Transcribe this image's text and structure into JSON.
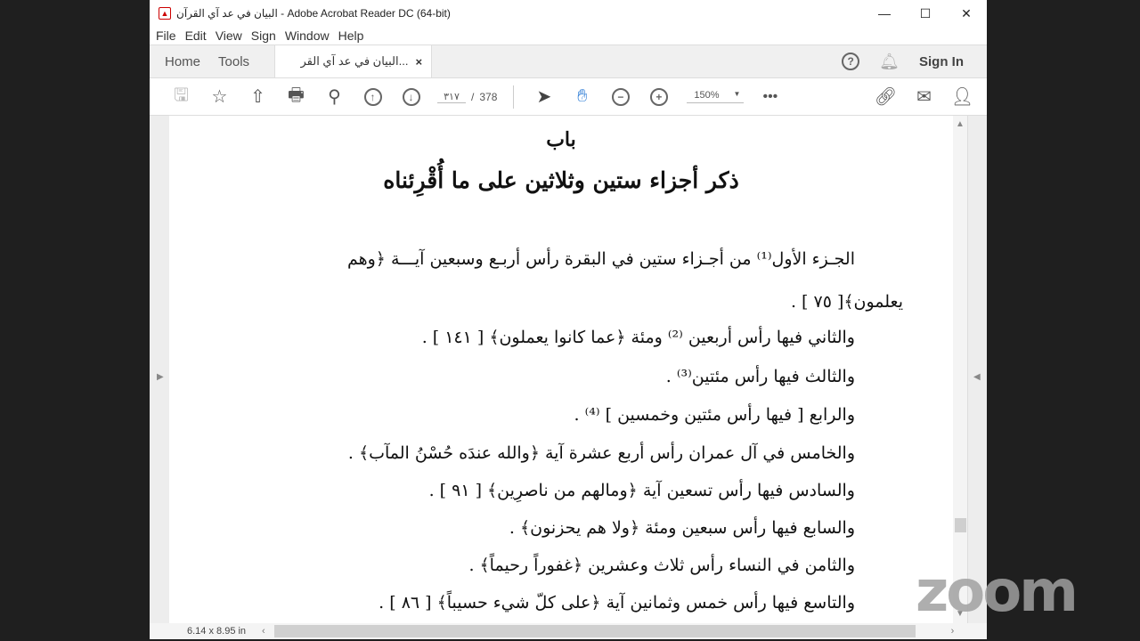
{
  "window": {
    "title": "البيان في عد آي القرآن - Adobe Acrobat Reader DC (64-bit)",
    "minimize": "—",
    "maximize": "☐",
    "close": "✕"
  },
  "menu": [
    "File",
    "Edit",
    "View",
    "Sign",
    "Window",
    "Help"
  ],
  "tabs": {
    "home": "Home",
    "tools": "Tools",
    "document": "البيان في عد آي القر...",
    "close": "×",
    "sign_in": "Sign In"
  },
  "toolbar": {
    "current_page": "٣١٧",
    "page_separator": "/",
    "total_pages": "378",
    "zoom": "150%"
  },
  "statusbar": {
    "page_size": "6.14 x 8.95 in"
  },
  "document": {
    "heading": "باب",
    "subheading": "ذكر أجزاء ستين وثلاثين على ما أُقْرِئناه",
    "lines": [
      "الجـزء الأول⁽¹⁾ من أجـزاء ستين في البقرة رأس أربـع وسبعين آيـــة ﴿وهم",
      "يعلمون﴾[ ٧٥ ] .",
      "والثاني فيها رأس أربعين ⁽²⁾ ومئة ﴿عما كانوا يعملون﴾ [ ١٤١ ] .",
      "والثالث فيها رأس مئتين⁽³⁾ .",
      "والرابع [ فيها رأس مئتين وخمسين ] ⁽⁴⁾ .",
      "والخامس في آل عمران رأس أربع عشرة آية ﴿والله عندَه حُسْنُ المآب﴾ .",
      "والسادس فيها رأس تسعين آية ﴿ومالهم من ناصرِين﴾ [ ٩١ ] .",
      "والسابع فيها رأس سبعين ومئة ﴿ولا هم يحزنون﴾ .",
      "والثامن في النساء رأس ثلاث وعشرين ﴿غفوراً رحيماً﴾ .",
      "والتاسع فيها رأس خمس وثمانين آية ﴿على كلّ شيء حسيباً﴾ [ ٨٦ ] ."
    ]
  },
  "watermark": "zoom"
}
